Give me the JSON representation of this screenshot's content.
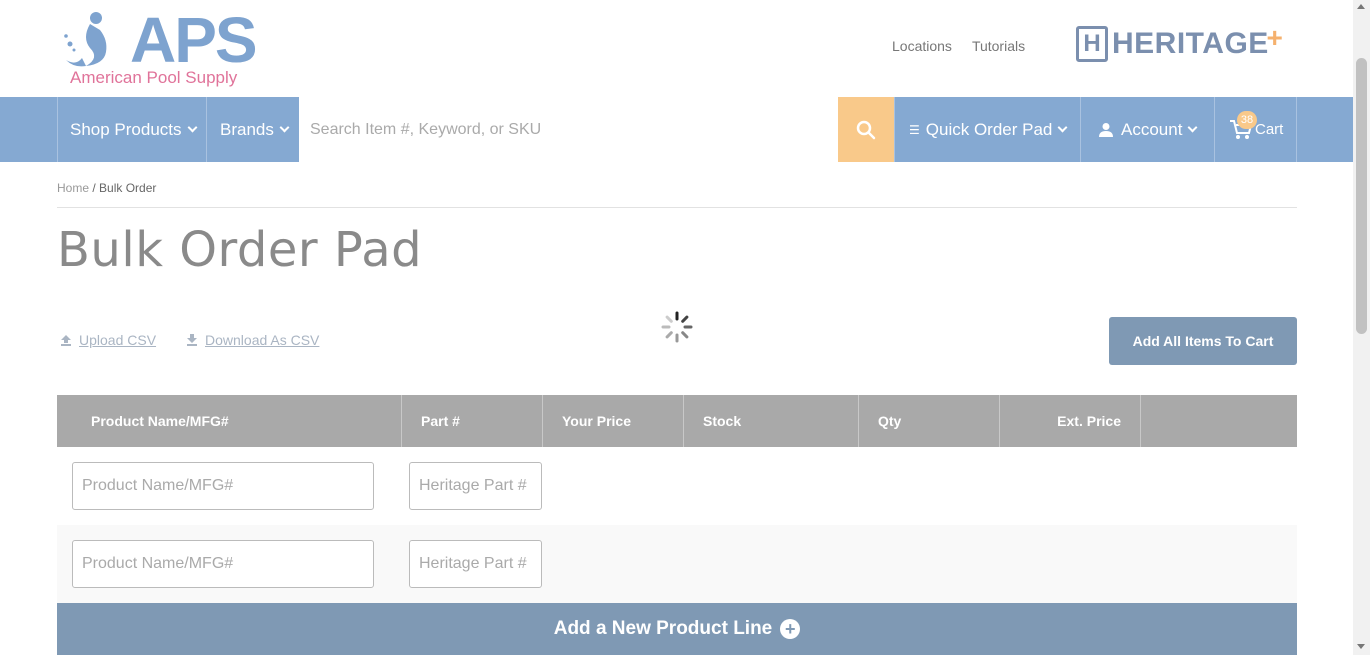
{
  "header": {
    "logo_text": "APS",
    "logo_tagline": "American Pool Supply",
    "links": [
      "Locations",
      "Tutorials"
    ],
    "partner_logo_text": "HERITAGE",
    "partner_logo_mark": "H",
    "partner_logo_plus": "+"
  },
  "nav": {
    "shop_products": "Shop Products",
    "brands": "Brands",
    "search_placeholder": "Search Item #, Keyword, or SKU",
    "quick_order": "Quick Order Pad",
    "account": "Account",
    "cart": "Cart",
    "cart_count": "38"
  },
  "breadcrumb": {
    "home": "Home",
    "separator": "/",
    "current": "Bulk Order"
  },
  "page_title": "Bulk Order Pad",
  "actions": {
    "upload_csv": "Upload CSV",
    "download_csv": "Download As CSV",
    "add_all": "Add All Items To Cart"
  },
  "table": {
    "columns": [
      "Product Name/MFG#",
      "Part #",
      "Your Price",
      "Stock",
      "Qty",
      "Ext. Price"
    ],
    "rows": [
      {
        "product_placeholder": "Product Name/MFG#",
        "part_placeholder": "Heritage Part #"
      },
      {
        "product_placeholder": "Product Name/MFG#",
        "part_placeholder": "Heritage Part #"
      }
    ],
    "add_line": "Add a New Product Line"
  },
  "colors": {
    "nav_bg": "#85a9d2",
    "search_button": "#f9c98a",
    "primary_button": "#7f99b4",
    "table_header": "#a9a9a9",
    "logo_blue": "#7ea3cf",
    "logo_pink": "#e0739a"
  }
}
